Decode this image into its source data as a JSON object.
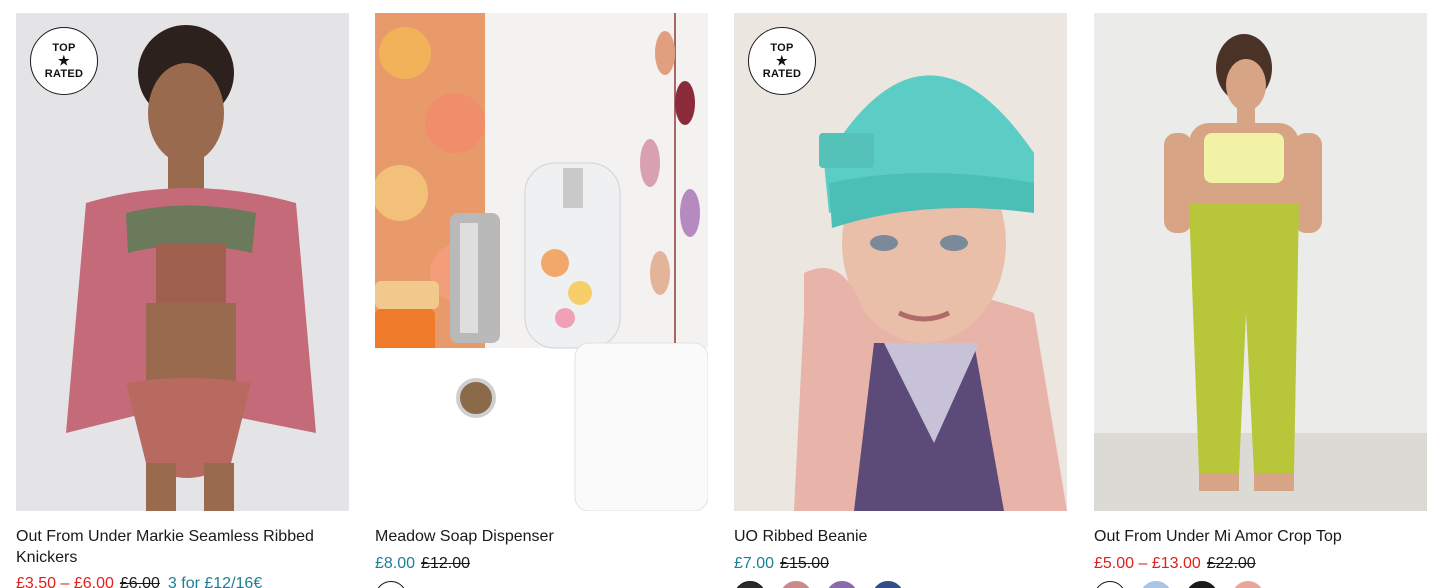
{
  "colors": {
    "sale_price": "#e0201b",
    "regular_price": "#1d7f96",
    "promo": "#1d7f96"
  },
  "badge": {
    "top": "TOP",
    "star": "★",
    "bottom": "RATED"
  },
  "products": [
    {
      "name": "Out From Under Markie Seamless Ribbed Knickers",
      "price": "£3.50 – £6.00",
      "price_color": "#e0201b",
      "was_price": "£6.00",
      "promo": "3 for £12/16€",
      "top_rated": true,
      "image": "model-pink-cardigan-knickers",
      "swatches": []
    },
    {
      "name": "Meadow Soap Dispenser",
      "price": "£8.00",
      "price_color": "#1d7f96",
      "was_price": "£12.00",
      "top_rated": false,
      "image": "glass-soap-dispenser-flowers",
      "swatches": [
        "#ffffff"
      ]
    },
    {
      "name": "UO Ribbed Beanie",
      "price": "£7.00",
      "price_color": "#1d7f96",
      "was_price": "£15.00",
      "top_rated": true,
      "image": "model-teal-beanie",
      "swatches": [
        "#2a2a2a",
        "#c98a8a",
        "#8a6aa8",
        "#2f4f8a"
      ]
    },
    {
      "name": "Out From Under Mi Amor Crop Top",
      "price": "£5.00 – £13.00",
      "price_color": "#e0201b",
      "was_price": "£22.00",
      "top_rated": false,
      "image": "model-yellow-crop-top-joggers",
      "swatches": [
        "#ffffff",
        "#a9c4e6",
        "#1a1a1a",
        "#e8a79a"
      ]
    }
  ]
}
